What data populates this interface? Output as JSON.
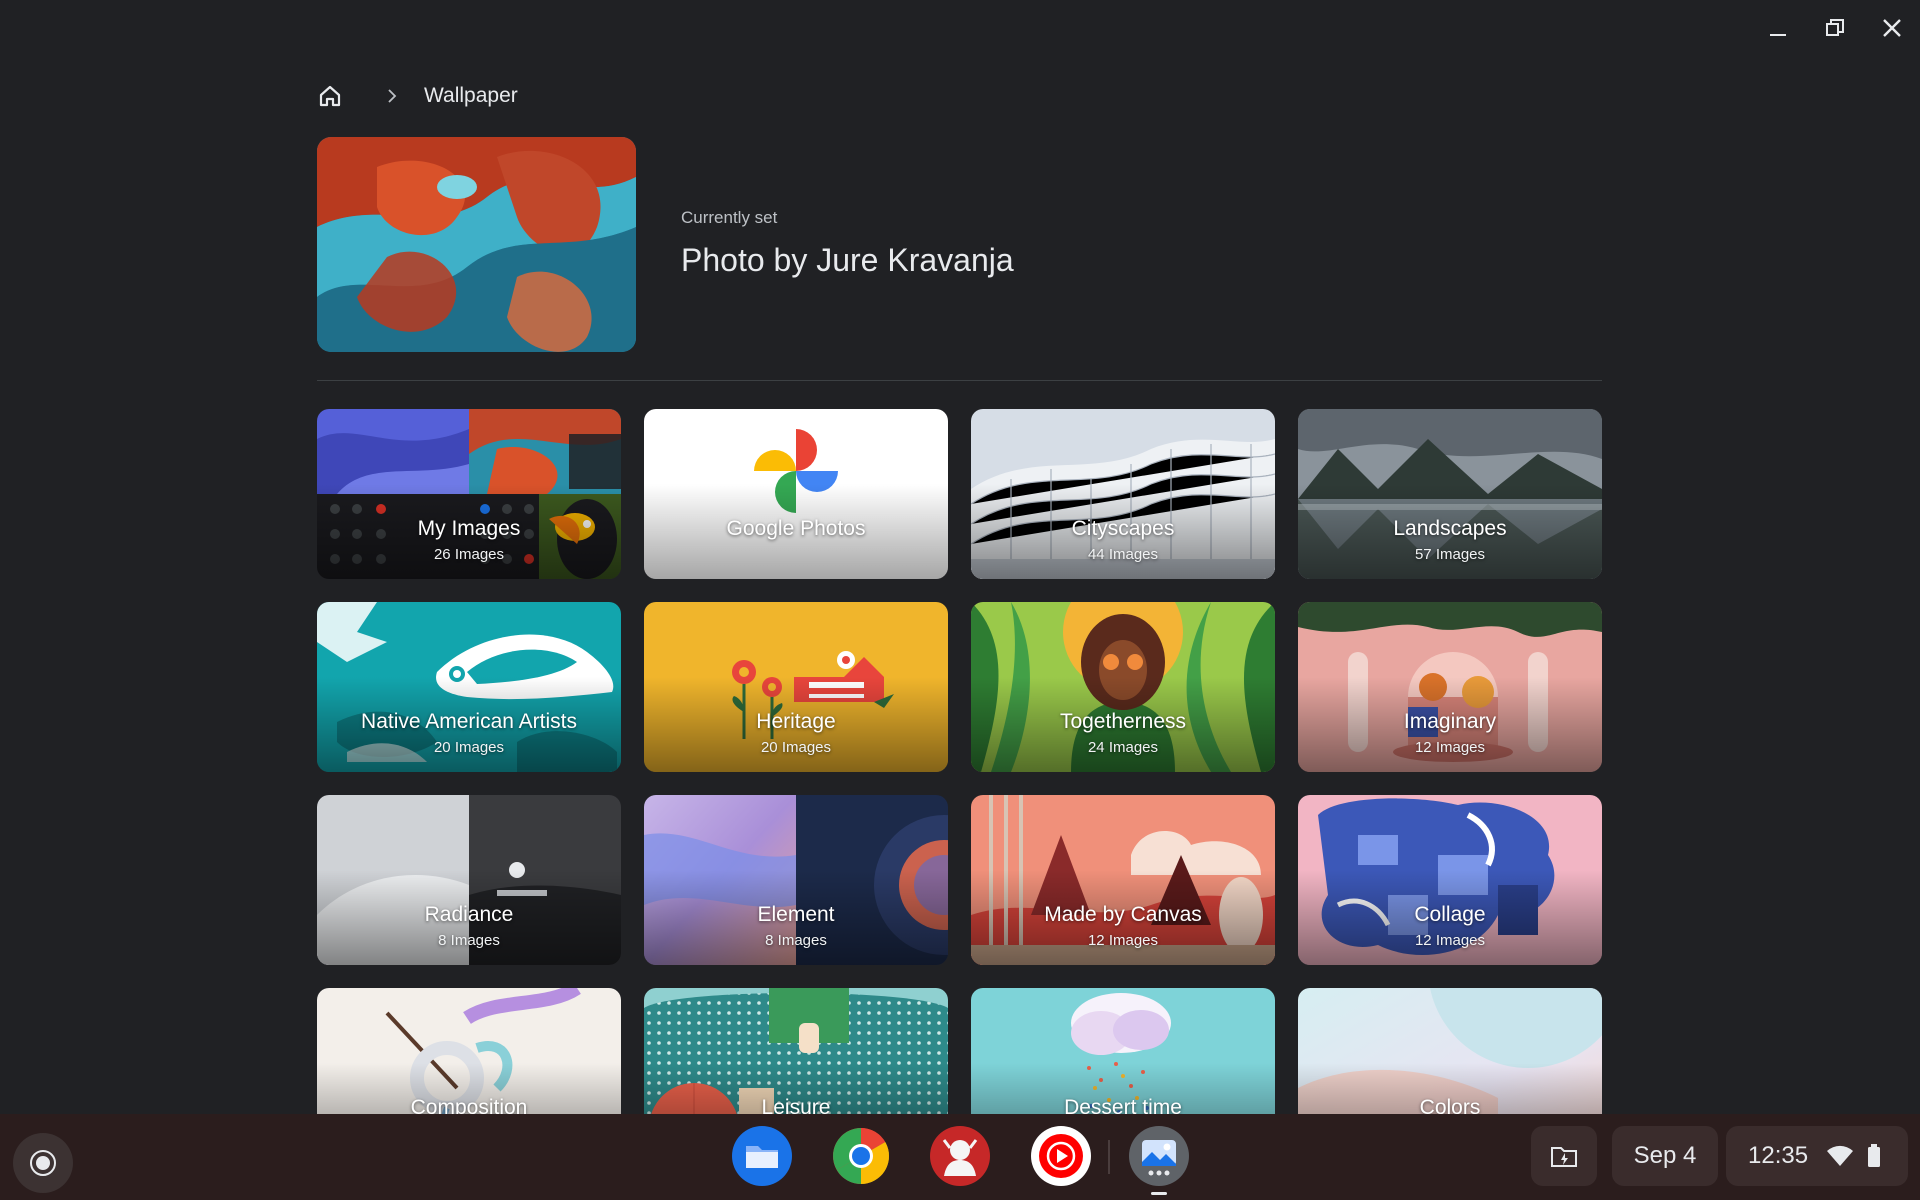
{
  "breadcrumb": {
    "current": "Wallpaper"
  },
  "current_wallpaper": {
    "label": "Currently set",
    "title": "Photo by Jure Kravanja"
  },
  "collections": [
    {
      "name": "My Images",
      "count": "26 Images"
    },
    {
      "name": "Google Photos",
      "count": ""
    },
    {
      "name": "Cityscapes",
      "count": "44 Images"
    },
    {
      "name": "Landscapes",
      "count": "57 Images"
    },
    {
      "name": "Native American Artists",
      "count": "20 Images"
    },
    {
      "name": "Heritage",
      "count": "20 Images"
    },
    {
      "name": "Togetherness",
      "count": "24 Images"
    },
    {
      "name": "Imaginary",
      "count": "12 Images"
    },
    {
      "name": "Radiance",
      "count": "8 Images"
    },
    {
      "name": "Element",
      "count": "8 Images"
    },
    {
      "name": "Made by Canvas",
      "count": "12 Images"
    },
    {
      "name": "Collage",
      "count": "12 Images"
    },
    {
      "name": "Composition",
      "count": ""
    },
    {
      "name": "Leisure",
      "count": ""
    },
    {
      "name": "Dessert time",
      "count": ""
    },
    {
      "name": "Colors",
      "count": ""
    }
  ],
  "shelf": {
    "apps": [
      "files-icon",
      "chrome-icon",
      "game-icon",
      "youtube-music-icon",
      "wallpaper-app-icon"
    ],
    "date": "Sep 4",
    "time": "12:35"
  },
  "colors": {
    "background": "#202124",
    "shelf": "#2b1d1d",
    "text": "#e8eaed"
  }
}
